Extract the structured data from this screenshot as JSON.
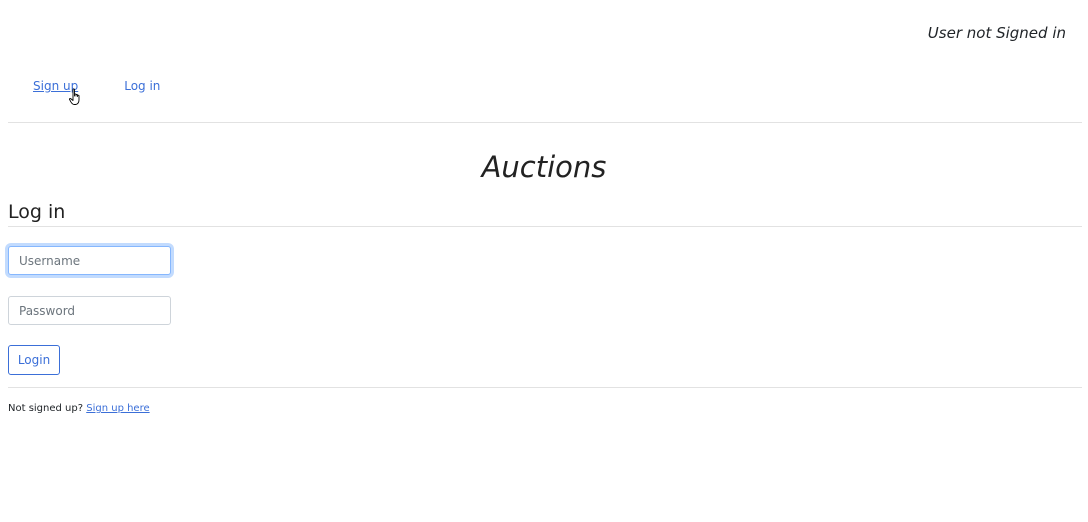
{
  "header": {
    "auth_status": "User not Signed in"
  },
  "nav": {
    "items": [
      {
        "label": "Sign up"
      },
      {
        "label": "Log in"
      }
    ]
  },
  "main": {
    "title": "Auctions",
    "section_heading": "Log in",
    "username": {
      "placeholder": "Username",
      "value": ""
    },
    "password": {
      "placeholder": "Password",
      "value": ""
    },
    "submit_label": "Login"
  },
  "footer": {
    "prompt": "Not signed up?",
    "link_label": "Sign up here"
  },
  "colors": {
    "link": "#3b6fd8",
    "focus_border": "#86b7fe"
  },
  "icons": {
    "cursor": "hand-pointer-icon"
  }
}
